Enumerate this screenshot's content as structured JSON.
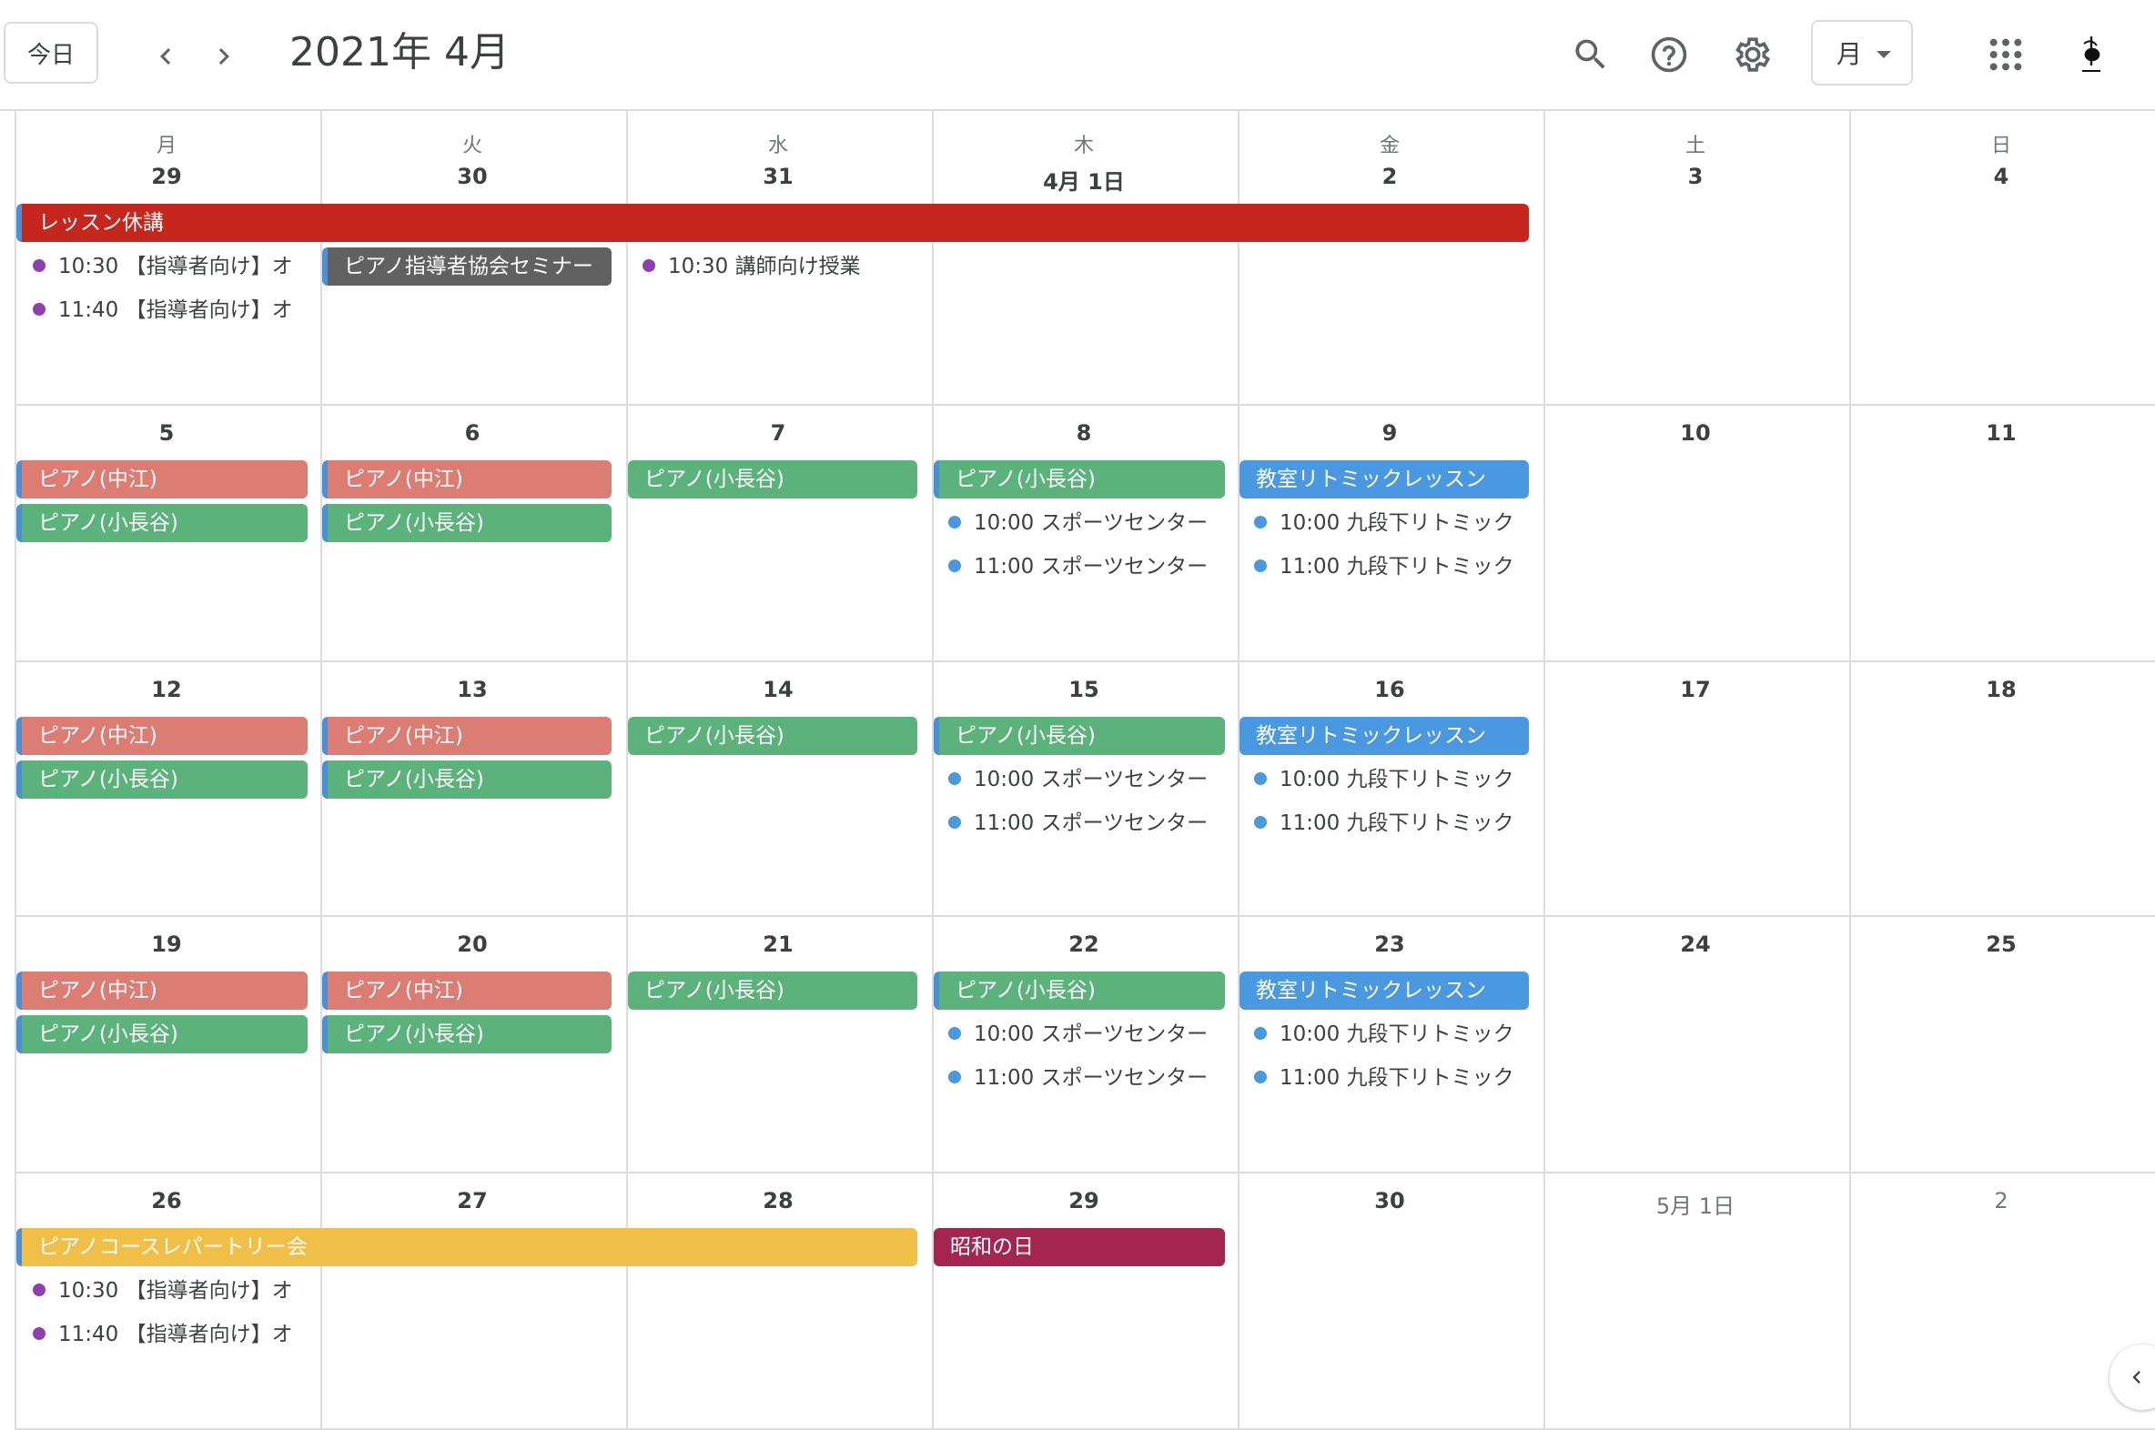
{
  "header": {
    "today_label": "今日",
    "title": "2021年 4月",
    "view_label": "月"
  },
  "weekdays": [
    "月",
    "火",
    "水",
    "木",
    "金",
    "土",
    "日"
  ],
  "weeks": [
    {
      "days": [
        "29",
        "30",
        "31",
        "4月 1日",
        "2",
        "3",
        "4"
      ]
    },
    {
      "days": [
        "5",
        "6",
        "7",
        "8",
        "9",
        "10",
        "11"
      ]
    },
    {
      "days": [
        "12",
        "13",
        "14",
        "15",
        "16",
        "17",
        "18"
      ]
    },
    {
      "days": [
        "19",
        "20",
        "21",
        "22",
        "23",
        "24",
        "25"
      ]
    },
    {
      "days": [
        "26",
        "27",
        "28",
        "29",
        "30",
        "5月 1日",
        "2"
      ]
    }
  ],
  "events": {
    "w0": {
      "lesson_off": "レッスン休講",
      "mon_1": "10:30 【指導者向け】オ",
      "mon_2": "11:40 【指導者向け】オ",
      "tue_1": "ピアノ指導者協会セミナー",
      "wed_1": "10:30 講師向け授業"
    },
    "w1": {
      "mon_1": "ピアノ(中江)",
      "mon_2": "ピアノ(小長谷)",
      "tue_1": "ピアノ(中江)",
      "tue_2": "ピアノ(小長谷)",
      "wed_1": "ピアノ(小長谷)",
      "thu_1": "ピアノ(小長谷)",
      "thu_2": "10:00 スポーツセンター",
      "thu_3": "11:00 スポーツセンター",
      "fri_1": "教室リトミックレッスン",
      "fri_2": "10:00 九段下リトミック",
      "fri_3": "11:00 九段下リトミック"
    },
    "w2": {
      "mon_1": "ピアノ(中江)",
      "mon_2": "ピアノ(小長谷)",
      "tue_1": "ピアノ(中江)",
      "tue_2": "ピアノ(小長谷)",
      "wed_1": "ピアノ(小長谷)",
      "thu_1": "ピアノ(小長谷)",
      "thu_2": "10:00 スポーツセンター",
      "thu_3": "11:00 スポーツセンター",
      "fri_1": "教室リトミックレッスン",
      "fri_2": "10:00 九段下リトミック",
      "fri_3": "11:00 九段下リトミック"
    },
    "w3": {
      "mon_1": "ピアノ(中江)",
      "mon_2": "ピアノ(小長谷)",
      "tue_1": "ピアノ(中江)",
      "tue_2": "ピアノ(小長谷)",
      "wed_1": "ピアノ(小長谷)",
      "thu_1": "ピアノ(小長谷)",
      "thu_2": "10:00 スポーツセンター",
      "thu_3": "11:00 スポーツセンター",
      "fri_1": "教室リトミックレッスン",
      "fri_2": "10:00 九段下リトミック",
      "fri_3": "11:00 九段下リトミック"
    },
    "w4": {
      "recital": "ピアノコースレパートリー会",
      "mon_1": "10:30 【指導者向け】オ",
      "mon_2": "11:40 【指導者向け】オ",
      "thu_1": "昭和の日"
    }
  },
  "colors": {
    "red": "#c5271e",
    "salmon": "#db7d73",
    "green": "#5bb27a",
    "blue": "#4a98df",
    "graphite": "#616161",
    "yellow": "#efbf47",
    "magenta": "#a32550",
    "purple": "#8e3fb0",
    "accent_stripe": "#4a90d9"
  },
  "icons": [
    "chevron-left-icon",
    "chevron-right-icon",
    "search-icon",
    "help-icon",
    "gear-icon",
    "apps-grid-icon",
    "account-avatar-icon",
    "sidebar-collapse-icon"
  ]
}
